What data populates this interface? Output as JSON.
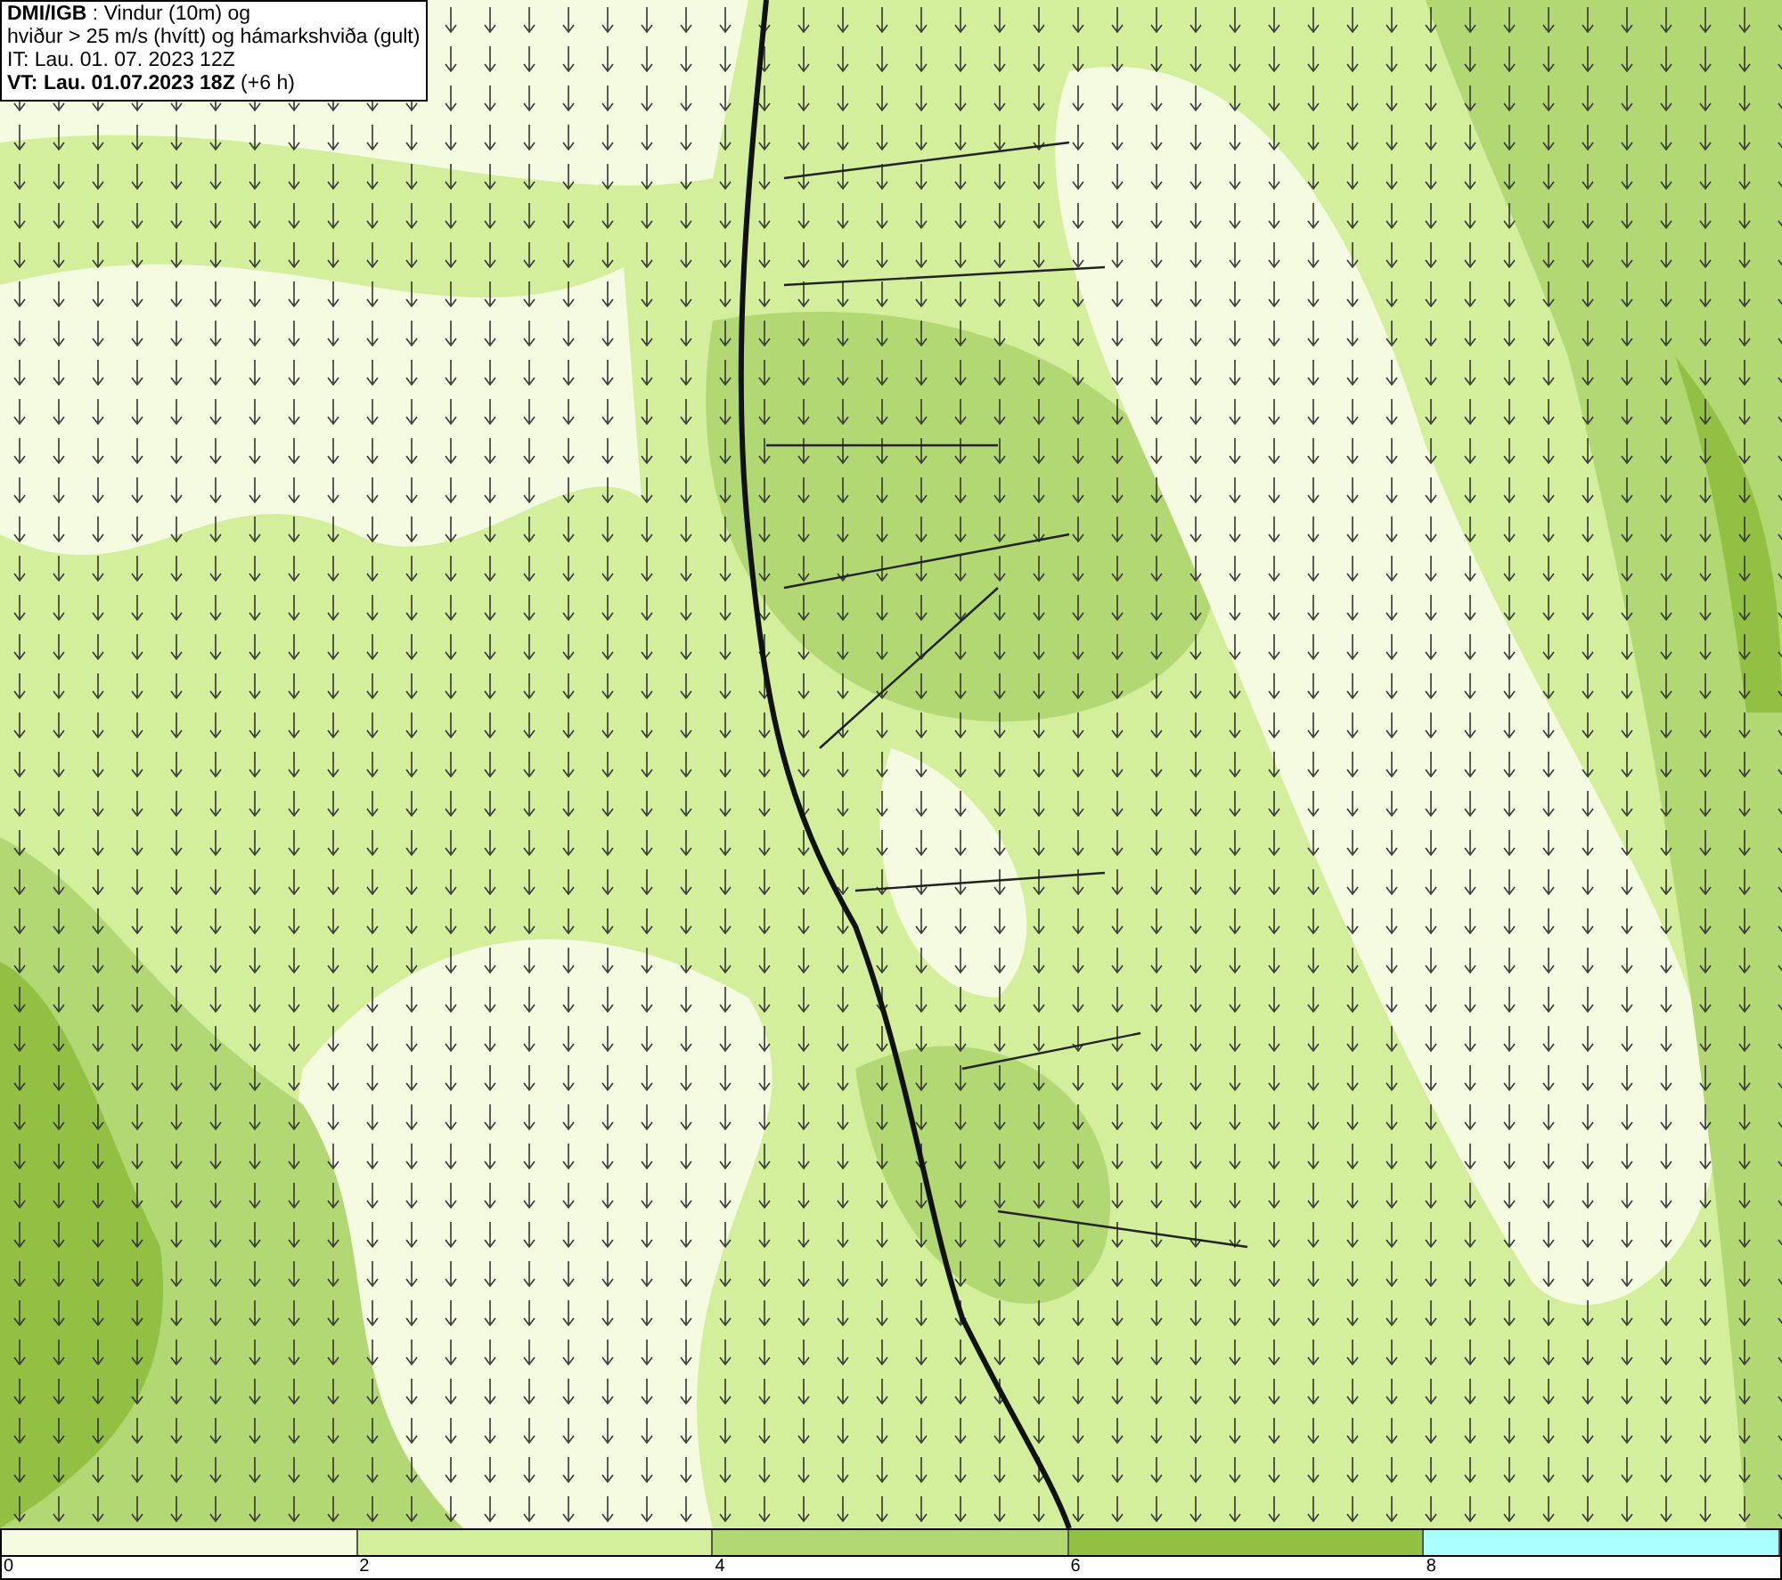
{
  "header": {
    "lines": [
      "**DMI/IGB** : Vindur (10m) og",
      "hviður > 25 m/s (hvítt) og hámarkshviða (gult)",
      "IT: Lau. 01. 07. 2023 12Z",
      "**VT: Lau. 01.07.2023 18Z** (+6 h)"
    ]
  },
  "legend": {
    "segments": [
      {
        "color": "#f4fbe0"
      },
      {
        "color": "#d3ef9c"
      },
      {
        "color": "#b2d873"
      },
      {
        "color": "#92c043"
      },
      {
        "color": "#aaffff"
      }
    ],
    "ticks": [
      "0",
      "2",
      "4",
      "6",
      "8"
    ]
  }
}
